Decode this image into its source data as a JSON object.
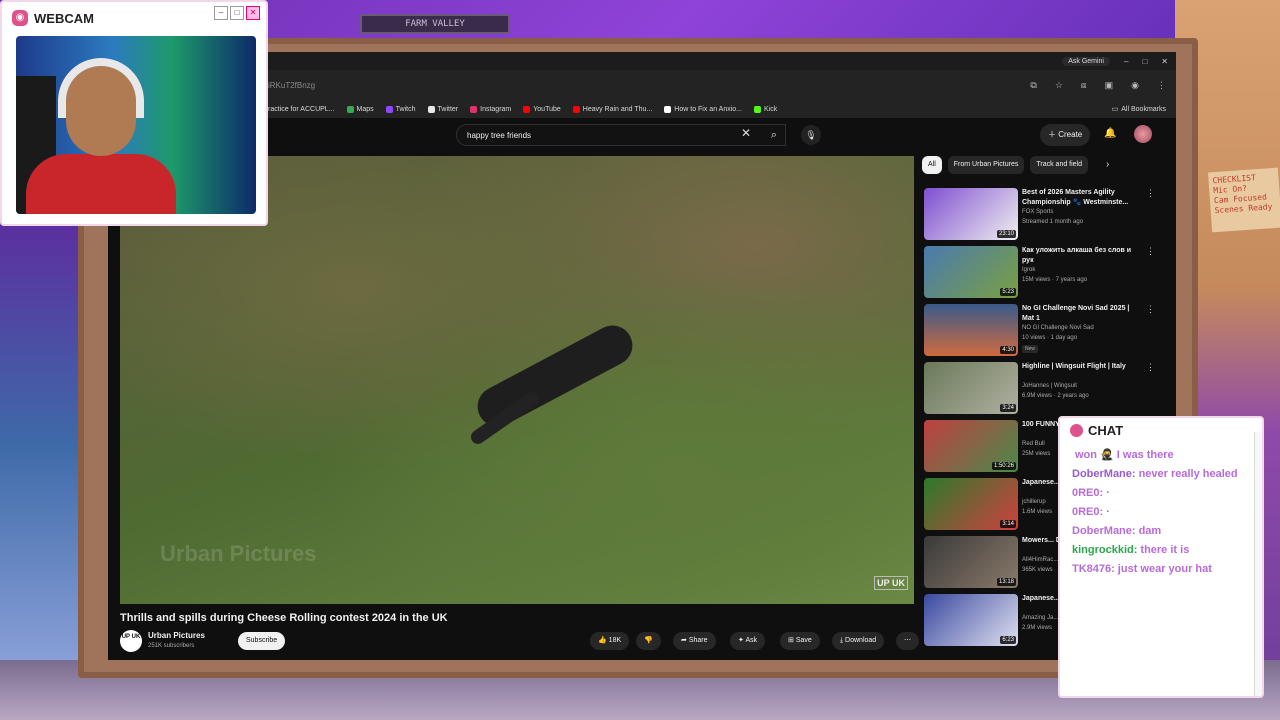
{
  "scene": {
    "shelf_label": "FARM VALLEY",
    "note_lines": [
      "CHECKLIST",
      "Mic On?",
      "Cam Focused",
      "Scenes Ready"
    ]
  },
  "webcam": {
    "title": "WEBCAM"
  },
  "browser": {
    "gemini": "Ask Gemini",
    "url": "iRKuT2fBnzg",
    "bookmarks": [
      {
        "label": "ractice for ACCUPL...",
        "color": "#888888"
      },
      {
        "label": "Maps",
        "color": "#34a853"
      },
      {
        "label": "Twitch",
        "color": "#9146ff"
      },
      {
        "label": "Twitter",
        "color": "#e7e7e7"
      },
      {
        "label": "Instagram",
        "color": "#e1306c"
      },
      {
        "label": "YouTube",
        "color": "#ff0000"
      },
      {
        "label": "Heavy Rain and Thu...",
        "color": "#ff0000"
      },
      {
        "label": "How to Fix an Anxio...",
        "color": "#ffffff"
      },
      {
        "label": "Kick",
        "color": "#53fc18"
      }
    ],
    "all_bookmarks": "All Bookmarks"
  },
  "youtube": {
    "search_value": "happy tree friends",
    "create": "Create",
    "video": {
      "watermark": "Urban Pictures",
      "logo": "UP UK",
      "title": "Thrills and spills during Cheese Rolling contest 2024 in the UK",
      "channel": "Urban Pictures",
      "subs": "251K subscribers",
      "avatar": "UP UK",
      "subscribe": "Subscribe",
      "likes": "18K",
      "share": "Share",
      "ask": "Ask",
      "save": "Save",
      "download": "Download"
    },
    "chips": [
      "All",
      "From Urban Pictures",
      "Track and field"
    ],
    "recs": [
      {
        "title": "Best of 2026 Masters Agility Championship 🐾 Westminste...",
        "channel": "FOX Sports",
        "meta": "Streamed 1 month ago",
        "dur": "23:10",
        "badge": ""
      },
      {
        "title": "Как уложить алкаша без слов и рук",
        "channel": "Igrok",
        "meta": "15M views · 7 years ago",
        "dur": "5:23",
        "badge": ""
      },
      {
        "title": "No GI Challenge Novi Sad 2025 | Mat 1",
        "channel": "NO GI Challenge Novi Sad",
        "meta": "10 views · 1 day ago",
        "dur": "4:30",
        "badge": "New"
      },
      {
        "title": "Highline | Wingsuit Flight | Italy",
        "channel": "JoHannes | Wingsuit",
        "meta": "6.9M views · 2 years ago",
        "dur": "3:24",
        "badge": ""
      },
      {
        "title": "100 FUNNY Soapbox R...",
        "channel": "Red Bull",
        "meta": "25M views",
        "dur": "1:50:26",
        "badge": ""
      },
      {
        "title": "Japanese...",
        "channel": "jchillerup",
        "meta": "1.6M views",
        "dur": "3:14",
        "badge": ""
      },
      {
        "title": "Mowers... Derby 20...",
        "channel": "All4HimRac...",
        "meta": "365K views",
        "dur": "13:18",
        "badge": ""
      },
      {
        "title": "Japanese... Taoshi]",
        "channel": "Amazing Ja...",
        "meta": "2.9M views",
        "dur": "6:23",
        "badge": ""
      }
    ]
  },
  "chat": {
    "title": "CHAT",
    "messages": [
      {
        "user": "",
        "text": "won 🥷 I was there"
      },
      {
        "user": "DoberMane:",
        "text": "never really healed"
      },
      {
        "user": "0RE0:",
        "text": "·"
      },
      {
        "user": "0RE0:",
        "text": "·"
      },
      {
        "user": "DoberMane:",
        "text": "dam"
      },
      {
        "user": "kingrockkid:",
        "text": "there it is"
      },
      {
        "user": "TK8476:",
        "text": "just wear your hat"
      }
    ]
  }
}
